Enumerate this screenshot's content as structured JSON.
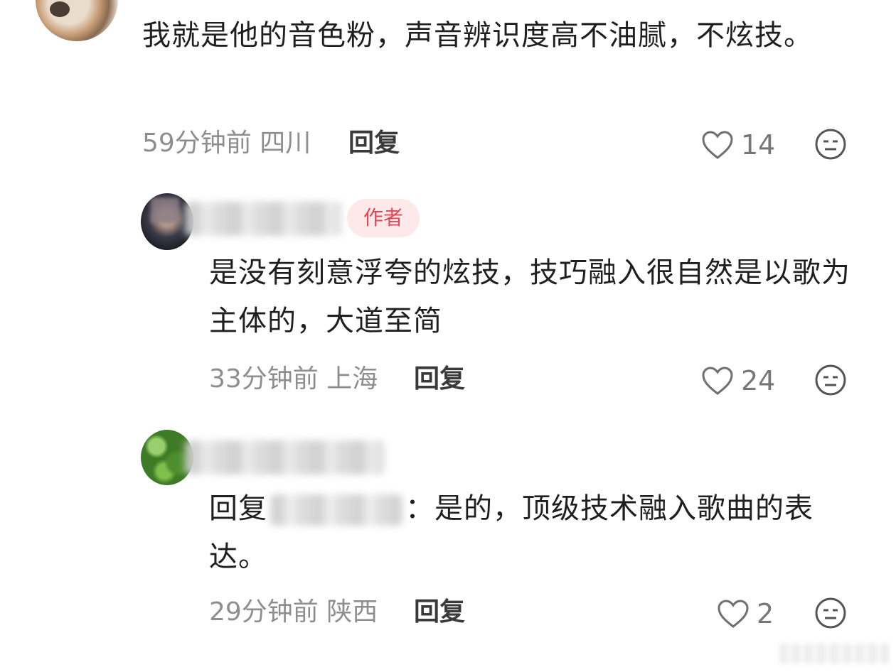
{
  "comments": [
    {
      "text": "我就是他的音色粉，声音辨识度高不油腻，不炫技。",
      "time": "59分钟前",
      "location": "四川",
      "reply_label": "回复",
      "likes": "14"
    },
    {
      "badge": "作者",
      "text": "是没有刻意浮夸的炫技，技巧融入很自然是以歌为主体的，大道至简",
      "time": "33分钟前",
      "location": "上海",
      "reply_label": "回复",
      "likes": "24"
    },
    {
      "reply_prefix": "回复",
      "reply_suffix": "：是的，顶级技术融入歌曲的表达。",
      "time": "29分钟前",
      "location": "陕西",
      "reply_label": "回复",
      "likes": "2"
    }
  ],
  "icons": {
    "like": "heart-outline-icon",
    "react": "expressionless-face-icon"
  },
  "colors": {
    "badge_text": "#e64553",
    "badge_bg": "#fde9ea",
    "meta": "#8e8e8e"
  }
}
